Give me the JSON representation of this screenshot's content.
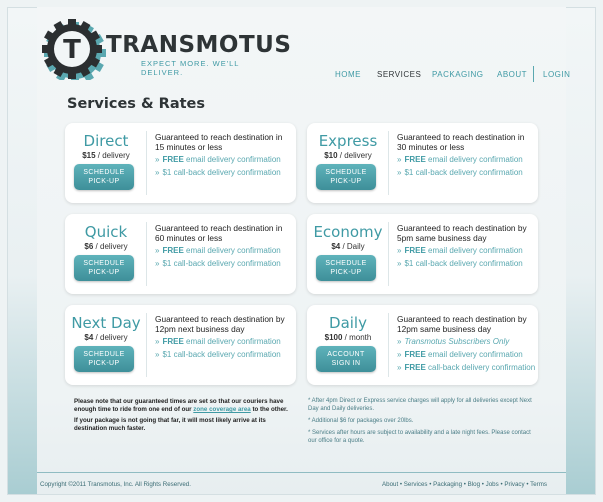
{
  "brand": {
    "name": "TRANSMOTUS",
    "tagline": "EXPECT MORE. WE'LL DELIVER.",
    "logo_letter": "T",
    "accent": "#3f9aa4",
    "dark": "#2e3436"
  },
  "nav": {
    "home": "HOME",
    "services": "SERVICES",
    "packaging": "PACKAGING",
    "about": "ABOUT",
    "login": "LOGIN"
  },
  "page_title": "Services & Rates",
  "services": [
    {
      "name": "Direct",
      "price": "$15",
      "unit": " / delivery",
      "button_line1": "SCHEDULE",
      "button_line2": "PICK-UP",
      "description": "Guaranteed to reach destination in 15 minutes or less",
      "features": [
        {
          "strong": "FREE",
          "rest": " email delivery confirmation"
        },
        {
          "strong": "",
          "rest": "$1 call-back delivery confirmation"
        }
      ]
    },
    {
      "name": "Express",
      "price": "$10",
      "unit": " / delivery",
      "button_line1": "SCHEDULE",
      "button_line2": "PICK-UP",
      "description": "Guaranteed to reach destination in 30 minutes or less",
      "features": [
        {
          "strong": "FREE",
          "rest": " email delivery confirmation"
        },
        {
          "strong": "",
          "rest": "$1 call-back delivery confirmation"
        }
      ]
    },
    {
      "name": "Quick",
      "price": "$6",
      "unit": " / delivery",
      "button_line1": "SCHEDULE",
      "button_line2": "PICK-UP",
      "description": "Guaranteed to reach destination in 60 minutes or less",
      "features": [
        {
          "strong": "FREE",
          "rest": " email delivery confirmation"
        },
        {
          "strong": "",
          "rest": "$1 call-back delivery confirmation"
        }
      ]
    },
    {
      "name": "Economy",
      "price": "$4",
      "unit": " / Daily",
      "button_line1": "SCHEDULE",
      "button_line2": "PICK-UP",
      "description": "Guaranteed to reach destination by 5pm same business day",
      "features": [
        {
          "strong": "FREE",
          "rest": " email delivery confirmation"
        },
        {
          "strong": "",
          "rest": "$1 call-back delivery confirmation"
        }
      ]
    },
    {
      "name": "Next Day",
      "price": "$4",
      "unit": " / delivery",
      "button_line1": "SCHEDULE",
      "button_line2": "PICK-UP",
      "description": "Guaranteed to reach destination by 12pm next business day",
      "features": [
        {
          "strong": "FREE",
          "rest": " email delivery confirmation"
        },
        {
          "strong": "",
          "rest": "$1 call-back delivery confirmation"
        }
      ]
    },
    {
      "name": "Daily",
      "price": "$100",
      "unit": " / month",
      "button_line1": "ACCOUNT",
      "button_line2": "SIGN IN",
      "description": "Guaranteed to reach destination by 12pm same business day",
      "features": [
        {
          "strong": "",
          "rest": "Transmotus Subscribers Only",
          "italic": true
        },
        {
          "strong": "FREE",
          "rest": " email delivery confirmation"
        },
        {
          "strong": "FREE",
          "rest": " call-back delivery confirmation"
        }
      ]
    }
  ],
  "notes_left": {
    "p1_before": "Please note that our guaranteed times are set so that our couriers have enough time to ride from one end of our ",
    "p1_link": "zone coverage area",
    "p1_after": " to the other.",
    "p2": "If your package is not going that far, it will most likely arrive at its destination much faster."
  },
  "notes_right": [
    "* After 4pm Direct or Express service charges will apply for all deliveries except Next Day and Daily deliveries.",
    "* Additional $6 for packages over 20lbs.",
    "* Services after hours are subject to availability and a late night fees. Please contact our office for a quote."
  ],
  "footer": {
    "copyright": "Copyright ©2011 Transmotus, Inc. All Rights Reserved.",
    "links": [
      "About",
      "Services",
      "Packaging",
      "Blog",
      "Jobs",
      "Privacy",
      "Terms"
    ],
    "separator": " • "
  }
}
